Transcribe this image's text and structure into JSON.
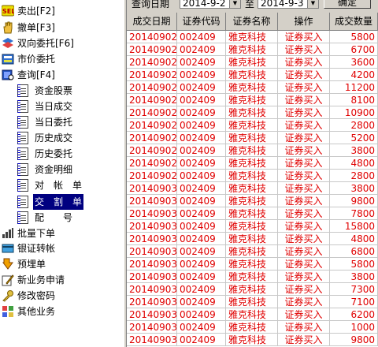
{
  "tree": {
    "items": [
      {
        "label": "卖出[F2]",
        "icon": "sell-icon",
        "color": "#d02020"
      },
      {
        "label": "撤单[F3]",
        "icon": "hand-icon",
        "color": "#e0a000"
      },
      {
        "label": "双向委托[F6]",
        "icon": "two-way-order-icon",
        "color": "#2060c0"
      },
      {
        "label": "市价委托",
        "icon": "market-order-icon",
        "color": "#2060c0"
      },
      {
        "label": "查询[F4]",
        "icon": "query-icon",
        "color": "#2060c0"
      },
      {
        "label": "资金股票",
        "icon": "doc-icon"
      },
      {
        "label": "当日成交",
        "icon": "doc-icon"
      },
      {
        "label": "当日委托",
        "icon": "doc-icon"
      },
      {
        "label": "历史成交",
        "icon": "doc-icon"
      },
      {
        "label": "历史委托",
        "icon": "doc-icon"
      },
      {
        "label": "资金明细",
        "icon": "doc-icon"
      },
      {
        "label": "对　帐　单",
        "icon": "doc-icon"
      },
      {
        "label": "交　割　单",
        "icon": "doc-icon",
        "selected": true
      },
      {
        "label": "配　　号",
        "icon": "doc-icon"
      },
      {
        "label": "批量下单",
        "icon": "batch-order-icon",
        "color": "#404040"
      },
      {
        "label": "银证转帐",
        "icon": "bank-transfer-icon",
        "color": "#2080c0"
      },
      {
        "label": "预埋单",
        "icon": "pre-order-icon",
        "color": "#e08000"
      },
      {
        "label": "新业务申请",
        "icon": "new-business-icon",
        "color": "#c0a000"
      },
      {
        "label": "修改密码",
        "icon": "key-icon",
        "color": "#c0a000"
      },
      {
        "label": "其他业务",
        "icon": "other-business-icon",
        "color": "#208040"
      }
    ]
  },
  "filter": {
    "label": "查询日期",
    "start_date": "2014-9-2",
    "to_label": "至",
    "end_date": "2014-9-3",
    "ok_label": "确定"
  },
  "table": {
    "columns": [
      "成交日期",
      "证券代码",
      "证券名称",
      "操作",
      "成交数量"
    ],
    "rows": [
      [
        "20140902",
        "002409",
        "雅克科技",
        "证券买入",
        "5800"
      ],
      [
        "20140902",
        "002409",
        "雅克科技",
        "证券买入",
        "6700"
      ],
      [
        "20140902",
        "002409",
        "雅克科技",
        "证券买入",
        "3600"
      ],
      [
        "20140902",
        "002409",
        "雅克科技",
        "证券买入",
        "4200"
      ],
      [
        "20140902",
        "002409",
        "雅克科技",
        "证券买入",
        "11200"
      ],
      [
        "20140902",
        "002409",
        "雅克科技",
        "证券买入",
        "8100"
      ],
      [
        "20140902",
        "002409",
        "雅克科技",
        "证券买入",
        "10900"
      ],
      [
        "20140902",
        "002409",
        "雅克科技",
        "证券买入",
        "2800"
      ],
      [
        "20140902",
        "002409",
        "雅克科技",
        "证券买入",
        "5200"
      ],
      [
        "20140902",
        "002409",
        "雅克科技",
        "证券买入",
        "3800"
      ],
      [
        "20140902",
        "002409",
        "雅克科技",
        "证券买入",
        "4800"
      ],
      [
        "20140902",
        "002409",
        "雅克科技",
        "证券买入",
        "2800"
      ],
      [
        "20140903",
        "002409",
        "雅克科技",
        "证券买入",
        "3800"
      ],
      [
        "20140903",
        "002409",
        "雅克科技",
        "证券买入",
        "9800"
      ],
      [
        "20140903",
        "002409",
        "雅克科技",
        "证券买入",
        "7800"
      ],
      [
        "20140903",
        "002409",
        "雅克科技",
        "证券买入",
        "15800"
      ],
      [
        "20140903",
        "002409",
        "雅克科技",
        "证券买入",
        "4800"
      ],
      [
        "20140903",
        "002409",
        "雅克科技",
        "证券买入",
        "6800"
      ],
      [
        "20140903",
        "002409",
        "雅克科技",
        "证券买入",
        "5800"
      ],
      [
        "20140903",
        "002409",
        "雅克科技",
        "证券买入",
        "3800"
      ],
      [
        "20140903",
        "002409",
        "雅克科技",
        "证券买入",
        "7300"
      ],
      [
        "20140903",
        "002409",
        "雅克科技",
        "证券买入",
        "7100"
      ],
      [
        "20140903",
        "002409",
        "雅克科技",
        "证券买入",
        "6200"
      ],
      [
        "20140903",
        "002409",
        "雅克科技",
        "证券买入",
        "1000"
      ],
      [
        "20140903",
        "002409",
        "雅克科技",
        "证券买入",
        "9800"
      ]
    ]
  }
}
